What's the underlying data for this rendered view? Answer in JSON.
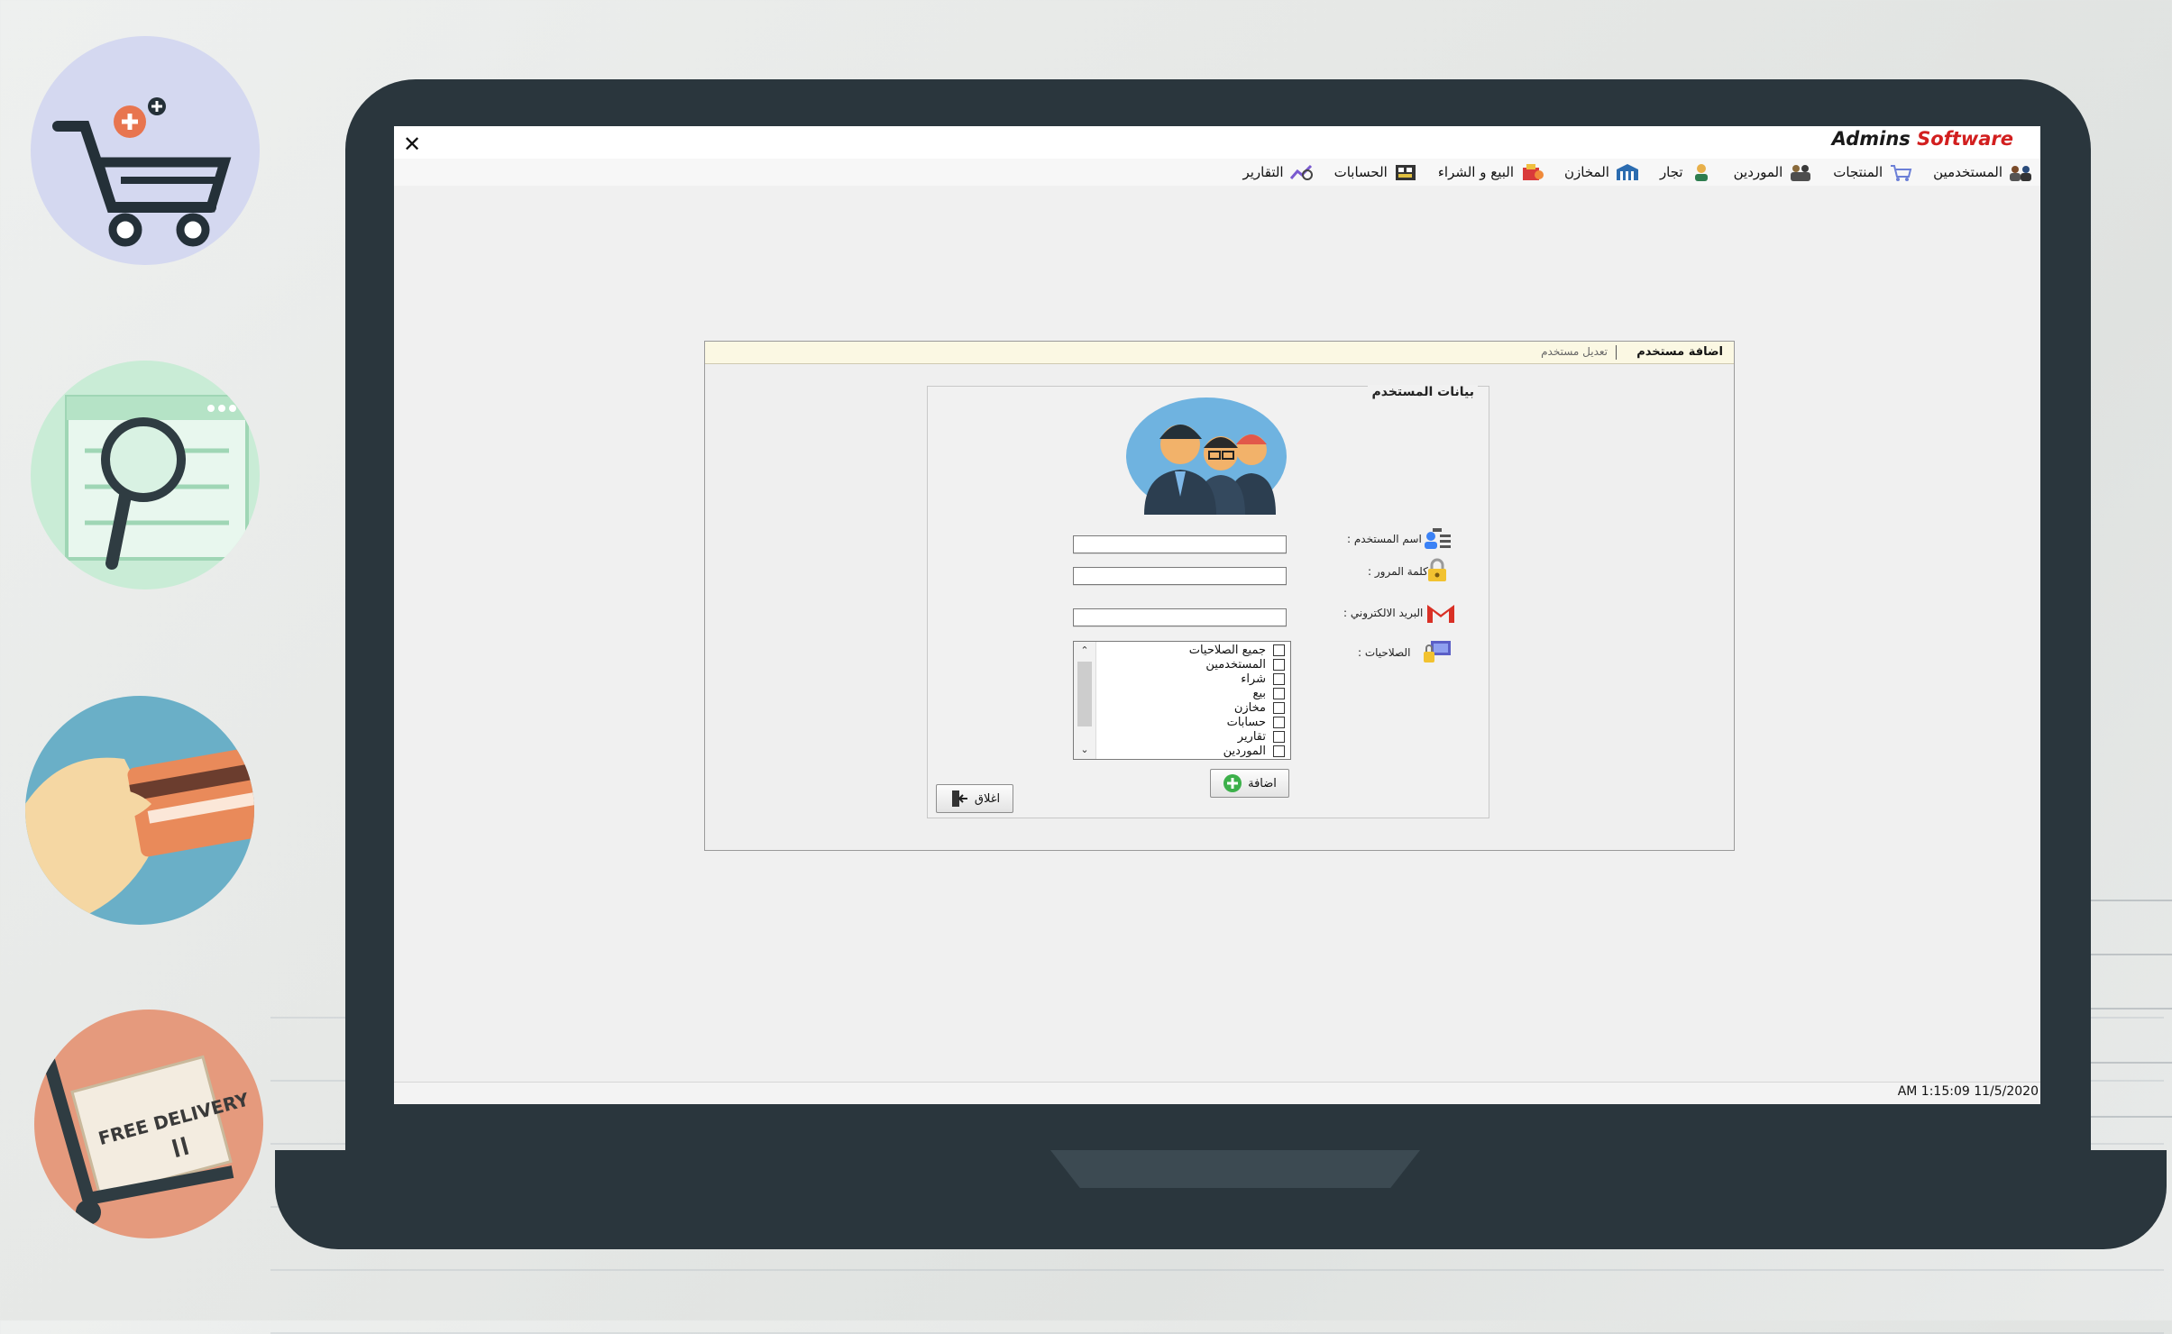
{
  "window": {
    "close_label": "✕",
    "brand_part1": "Admins",
    "brand_part2": "Software"
  },
  "menu": [
    {
      "label": "المستخدمين",
      "icon": "users-group-icon"
    },
    {
      "label": "المنتجات",
      "icon": "cart-icon"
    },
    {
      "label": "الموردين",
      "icon": "suppliers-icon"
    },
    {
      "label": "تجار",
      "icon": "merchant-icon"
    },
    {
      "label": "المخازن",
      "icon": "warehouse-icon"
    },
    {
      "label": "البيع و الشراء",
      "icon": "sales-icon"
    },
    {
      "label": "الحسابات",
      "icon": "accounts-icon"
    },
    {
      "label": "التقارير",
      "icon": "reports-icon"
    }
  ],
  "dialog": {
    "tab_add": "اضافة مستخدم",
    "tab_edit": "تعديل مستخدم",
    "group_title": "بيانات المستخدم",
    "username_label": "اسم المستخدم :",
    "password_label": "كلمة المرور :",
    "email_label": "البريد الالكتروني :",
    "permissions_label": "الصلاحيات :",
    "username_value": "",
    "password_value": "",
    "email_value": "",
    "permissions": [
      "جميع الصلاحيات",
      "المستخدمين",
      "شراء",
      "بيع",
      "مخازن",
      "حسابات",
      "تقارير",
      "الموردين"
    ],
    "add_button": "اضافة",
    "close_button": "اغلاق"
  },
  "status": {
    "clock": "AM 1:15:09 11/5/2020"
  },
  "colors": {
    "laptop": "#2a363d",
    "brand_red": "#d21f1f",
    "tab_strip": "#fbf8e3"
  }
}
